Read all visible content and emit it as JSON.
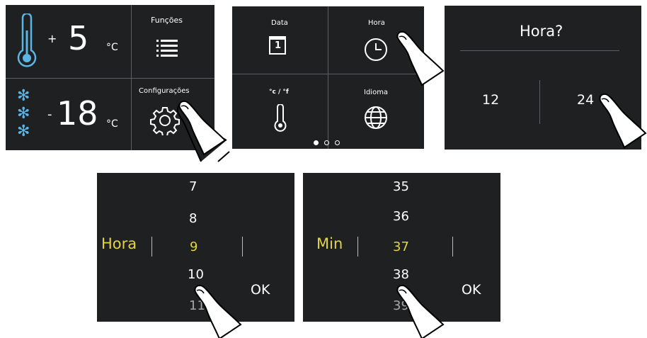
{
  "screen1": {
    "fridge_sign": "+",
    "fridge_temp": "5",
    "fridge_unit": "°C",
    "freezer_sign": "-",
    "freezer_temp": "18",
    "freezer_unit": "°C",
    "funcoes_label": "Funções",
    "config_label": "Configurações"
  },
  "screen2": {
    "data_label": "Data",
    "calendar_day": "1",
    "hora_label": "Hora",
    "unit_label": "°c / °f",
    "idioma_label": "Idioma",
    "pagination_active_index": 0,
    "pagination_count": 3
  },
  "screen3": {
    "question": "Hora?",
    "option_12": "12",
    "option_24": "24"
  },
  "screen4": {
    "label": "Hora",
    "values": [
      "7",
      "8",
      "9",
      "10",
      "11"
    ],
    "selected": "9",
    "ok_label": "OK"
  },
  "screen5": {
    "label": "Min",
    "values": [
      "35",
      "36",
      "37",
      "38",
      "39"
    ],
    "selected": "37",
    "ok_label": "OK"
  },
  "colors": {
    "panel_bg": "#1e2022",
    "accent_blue": "#5bb6e6",
    "highlight_yellow": "#e2d447",
    "divider": "#5c5f62"
  }
}
